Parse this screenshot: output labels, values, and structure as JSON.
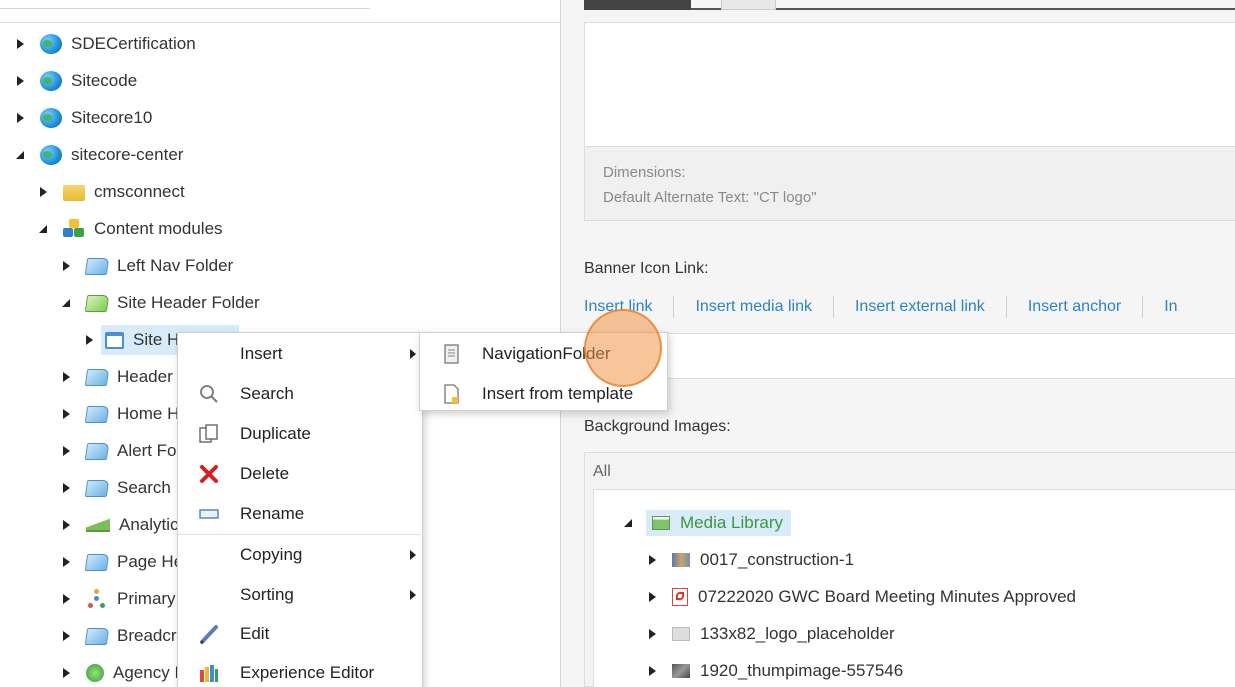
{
  "tree": {
    "nodes": [
      {
        "label": "SDECertification",
        "state": "collapsed",
        "icon": "globe-icon"
      },
      {
        "label": "Sitecode",
        "state": "collapsed",
        "icon": "globe-icon"
      },
      {
        "label": "Sitecore10",
        "state": "collapsed",
        "icon": "globe-icon"
      },
      {
        "label": "sitecore-center",
        "state": "expanded",
        "icon": "globe-icon"
      },
      {
        "label": "cmsconnect",
        "state": "collapsed",
        "icon": "folder-icon"
      },
      {
        "label": "Content modules",
        "state": "expanded",
        "icon": "modules-icon"
      },
      {
        "label": "Left Nav Folder",
        "state": "collapsed",
        "icon": "blue-folder-icon"
      },
      {
        "label": "Site Header Folder",
        "state": "expanded",
        "icon": "green-folder-icon"
      },
      {
        "label": "Site H",
        "state": "collapsed",
        "icon": "window-icon",
        "selected": true
      },
      {
        "label": "Header I",
        "state": "collapsed",
        "icon": "blue-folder-icon"
      },
      {
        "label": "Home H",
        "state": "collapsed",
        "icon": "blue-folder-icon"
      },
      {
        "label": "Alert Fol",
        "state": "collapsed",
        "icon": "blue-folder-icon"
      },
      {
        "label": "Search F",
        "state": "collapsed",
        "icon": "blue-folder-icon"
      },
      {
        "label": "Analytics",
        "state": "collapsed",
        "icon": "chart-icon"
      },
      {
        "label": "Page He",
        "state": "collapsed",
        "icon": "blue-folder-icon"
      },
      {
        "label": "Primary",
        "state": "collapsed",
        "icon": "hierarchy-icon"
      },
      {
        "label": "Breadcru",
        "state": "collapsed",
        "icon": "blue-folder-icon"
      },
      {
        "label": "Agency I",
        "state": "collapsed",
        "icon": "agency-icon"
      }
    ]
  },
  "context_menu": {
    "items": [
      {
        "label": "Insert",
        "icon": "",
        "submenu": true
      },
      {
        "label": "Search",
        "icon": "search-icon"
      },
      {
        "label": "Duplicate",
        "icon": "duplicate-icon"
      },
      {
        "label": "Delete",
        "icon": "delete-icon"
      },
      {
        "label": "Rename",
        "icon": "rename-icon"
      },
      {
        "label": "Copying",
        "icon": "",
        "submenu": true
      },
      {
        "label": "Sorting",
        "icon": "",
        "submenu": true
      },
      {
        "label": "Edit",
        "icon": "edit-icon"
      },
      {
        "label": "Experience Editor",
        "icon": "experience-editor-icon"
      }
    ]
  },
  "insert_submenu": {
    "items": [
      {
        "label": "NavigationFolder",
        "icon": "navigation-folder-icon"
      },
      {
        "label": "Insert from template",
        "icon": "template-icon"
      }
    ]
  },
  "editor": {
    "image_info": {
      "dimensions": "Dimensions:",
      "alt_text": "Default Alternate Text: \"CT logo\""
    },
    "banner_icon_link": {
      "label": "Banner Icon Link:",
      "links": [
        "Insert link",
        "Insert media link",
        "Insert external link",
        "Insert anchor",
        "In"
      ]
    },
    "background_images": {
      "label": "Background Images:",
      "filter_label": "All",
      "root": "Media Library",
      "items": [
        {
          "label": "0017_construction-1",
          "icon": "image-icon"
        },
        {
          "label": "07222020 GWC Board Meeting Minutes Approved",
          "icon": "pdf-icon"
        },
        {
          "label": "133x82_logo_placeholder",
          "icon": "image-icon"
        },
        {
          "label": "1920_thumpimage-557546",
          "icon": "image-icon"
        }
      ]
    }
  },
  "colors": {
    "link": "#2b84c6",
    "selection": "#d7ebfb",
    "cursor_highlight": "#f0964b",
    "media_root_text": "#3a9a3a"
  }
}
